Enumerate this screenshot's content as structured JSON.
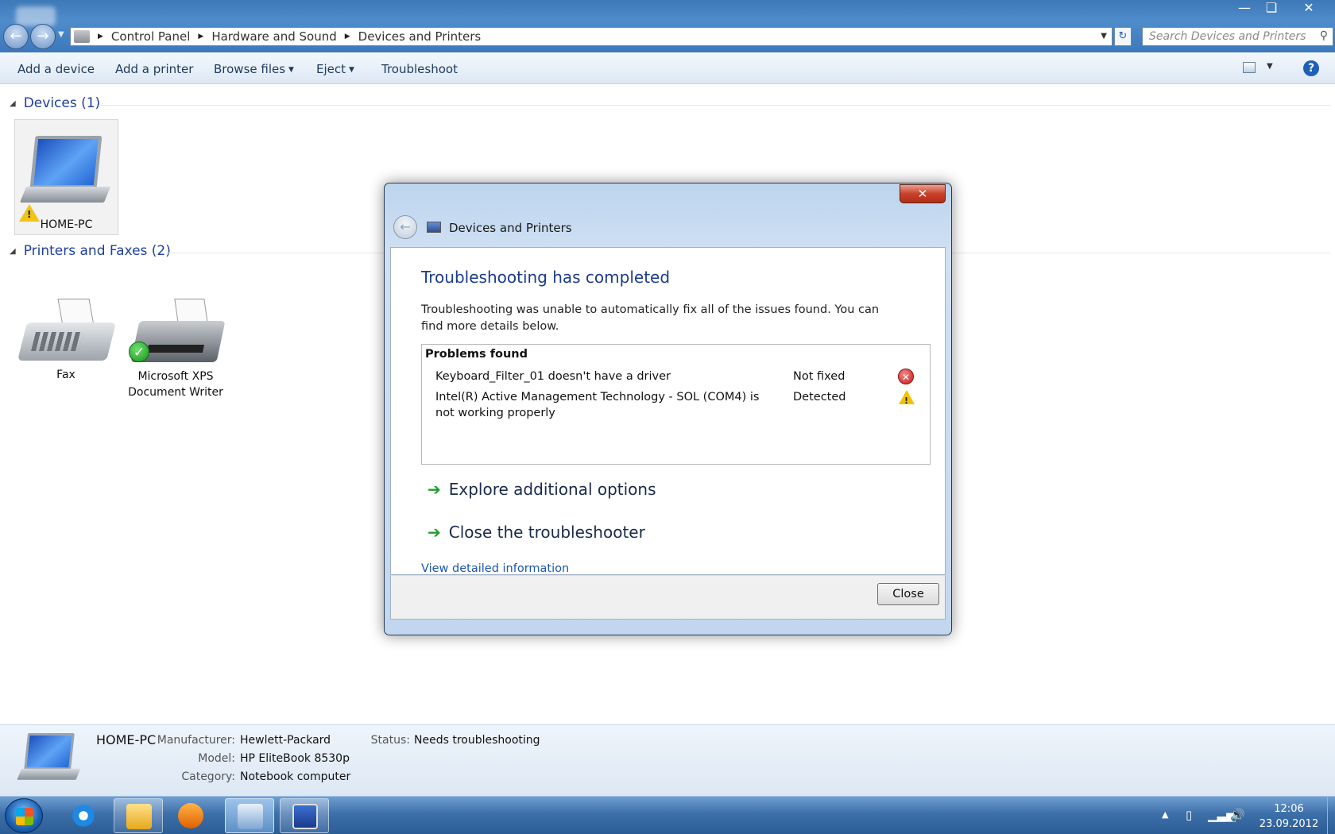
{
  "window": {
    "address": [
      "Control Panel",
      "Hardware and Sound",
      "Devices and Printers"
    ],
    "search_placeholder": "Search Devices and Printers"
  },
  "toolbar": {
    "add_device": "Add a device",
    "add_printer": "Add a printer",
    "browse_files": "Browse files",
    "eject": "Eject",
    "troubleshoot": "Troubleshoot",
    "help": "?"
  },
  "groups": {
    "devices": "Devices (1)",
    "printers": "Printers and Faxes (2)"
  },
  "devices": {
    "home_pc": "HOME-PC",
    "fax": "Fax",
    "xps_line1": "Microsoft XPS",
    "xps_line2": "Document Writer"
  },
  "details": {
    "name": "HOME-PC",
    "manufacturer_label": "Manufacturer:",
    "manufacturer": "Hewlett-Packard",
    "model_label": "Model:",
    "model": "HP EliteBook 8530p",
    "category_label": "Category:",
    "category": "Notebook computer",
    "status_label": "Status:",
    "status": "Needs troubleshooting"
  },
  "dialog": {
    "title": "Devices and Printers",
    "heading": "Troubleshooting has completed",
    "description": "Troubleshooting was unable to automatically fix all of the issues found. You can find more details below.",
    "problems_header": "Problems found",
    "problems": [
      {
        "name": "Keyboard_Filter_01 doesn't have a driver",
        "status": "Not fixed",
        "icon": "error-icon"
      },
      {
        "name": "Intel(R) Active Management Technology - SOL (COM4) is not working properly",
        "status": "Detected",
        "icon": "warning-icon"
      }
    ],
    "option_explore": "Explore additional options",
    "option_close": "Close the troubleshooter",
    "view_details": "View detailed information",
    "close_button": "Close"
  },
  "taskbar": {
    "time": "12:06",
    "date": "23.09.2012"
  }
}
